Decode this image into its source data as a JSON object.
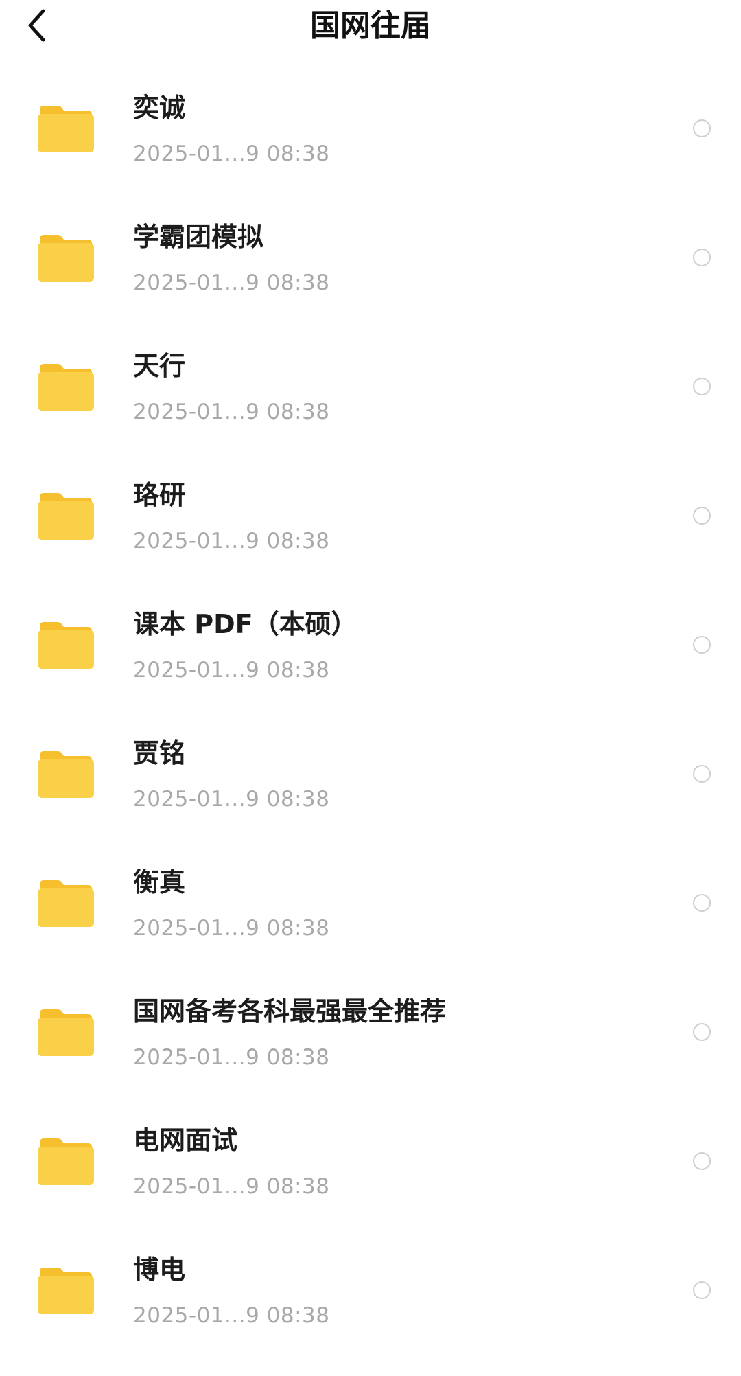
{
  "header": {
    "title": "国网往届",
    "back_icon": "chevron-left-icon"
  },
  "colors": {
    "folder_body": "#fbd049",
    "folder_tab": "#f5bf2e",
    "meta_text": "#a8a8a8",
    "radio_border": "#cfcfcf"
  },
  "files": [
    {
      "name": "奕诚",
      "date": "2025-01...9 08:38",
      "icon": "folder-icon",
      "selected": false
    },
    {
      "name": "学霸团模拟",
      "date": "2025-01...9 08:38",
      "icon": "folder-icon",
      "selected": false
    },
    {
      "name": "天行",
      "date": "2025-01...9 08:38",
      "icon": "folder-icon",
      "selected": false
    },
    {
      "name": "珞研",
      "date": "2025-01...9 08:38",
      "icon": "folder-icon",
      "selected": false
    },
    {
      "name": "课本 PDF（本硕）",
      "date": "2025-01...9 08:38",
      "icon": "folder-icon",
      "selected": false
    },
    {
      "name": "贾铭",
      "date": "2025-01...9 08:38",
      "icon": "folder-icon",
      "selected": false
    },
    {
      "name": "衡真",
      "date": "2025-01...9 08:38",
      "icon": "folder-icon",
      "selected": false
    },
    {
      "name": "国网备考各科最强最全推荐",
      "date": "2025-01...9 08:38",
      "icon": "folder-icon",
      "selected": false
    },
    {
      "name": "电网面试",
      "date": "2025-01...9 08:38",
      "icon": "folder-icon",
      "selected": false
    },
    {
      "name": "博电",
      "date": "2025-01...9 08:38",
      "icon": "folder-icon",
      "selected": false
    }
  ]
}
